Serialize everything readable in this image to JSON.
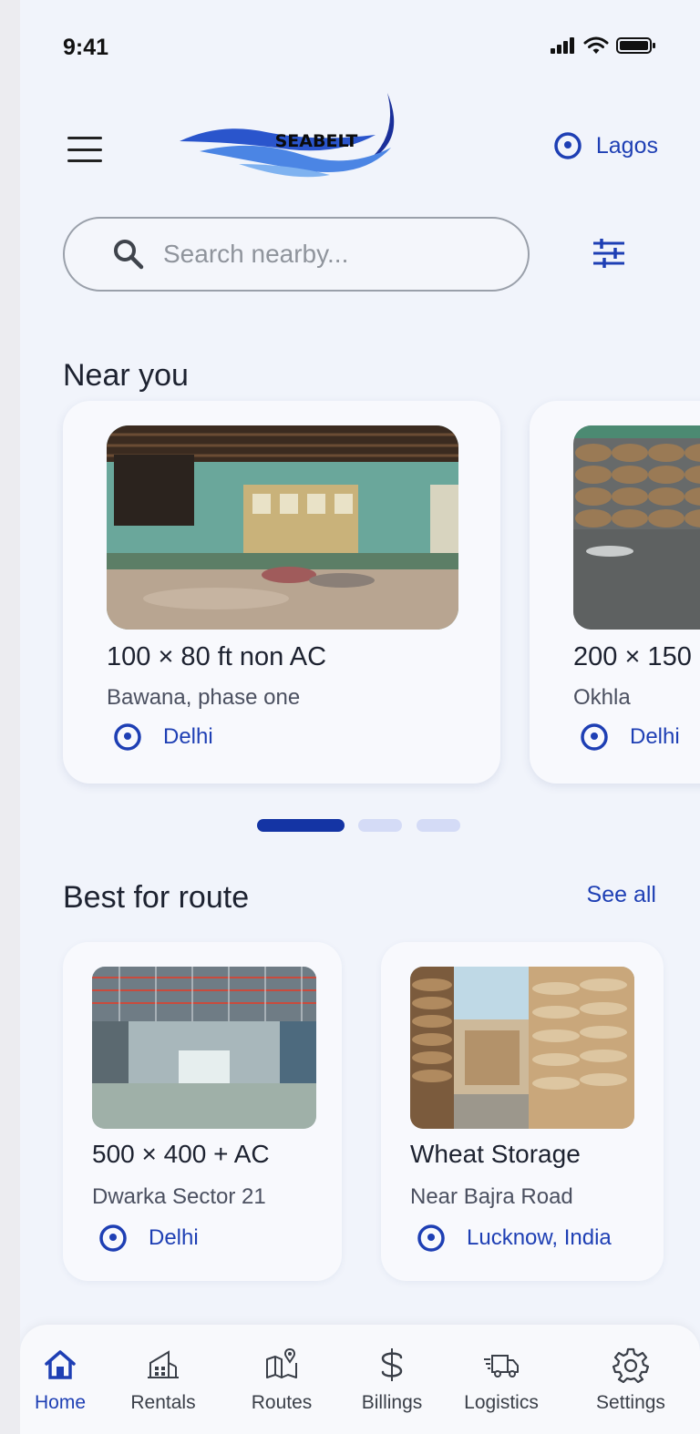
{
  "status_bar": {
    "time": "9:41"
  },
  "header": {
    "logo_text": "SEABELT",
    "location": "Lagos"
  },
  "search": {
    "placeholder": "Search nearby..."
  },
  "near_you": {
    "title": "Near you",
    "cards": [
      {
        "title": "100 × 80 ft non AC",
        "subtitle": "Bawana, phase one",
        "city": "Delhi"
      },
      {
        "title": "200 × 150",
        "subtitle": "Okhla",
        "city": "Delhi"
      }
    ],
    "pager": {
      "count": 3,
      "active": 1
    }
  },
  "best_for_route": {
    "title": "Best for route",
    "see_all": "See all",
    "cards": [
      {
        "title": "500 × 400 + AC",
        "subtitle": "Dwarka Sector 21",
        "city": "Delhi"
      },
      {
        "title": "Wheat Storage",
        "subtitle": "Near Bajra Road",
        "city": "Lucknow, India"
      }
    ]
  },
  "bottom_nav": {
    "items": [
      {
        "label": "Home",
        "icon": "home-icon",
        "active": true
      },
      {
        "label": "Rentals",
        "icon": "building-icon",
        "active": false
      },
      {
        "label": "Routes",
        "icon": "map-icon",
        "active": false
      },
      {
        "label": "Billings",
        "icon": "dollar-icon",
        "active": false
      },
      {
        "label": "Logistics",
        "icon": "truck-icon",
        "active": false
      },
      {
        "label": "Settings",
        "icon": "gear-icon",
        "active": false
      }
    ]
  },
  "colors": {
    "accent": "#1e3fb4",
    "background": "#f1f4fb",
    "pager_inactive": "#d4dbf6"
  }
}
